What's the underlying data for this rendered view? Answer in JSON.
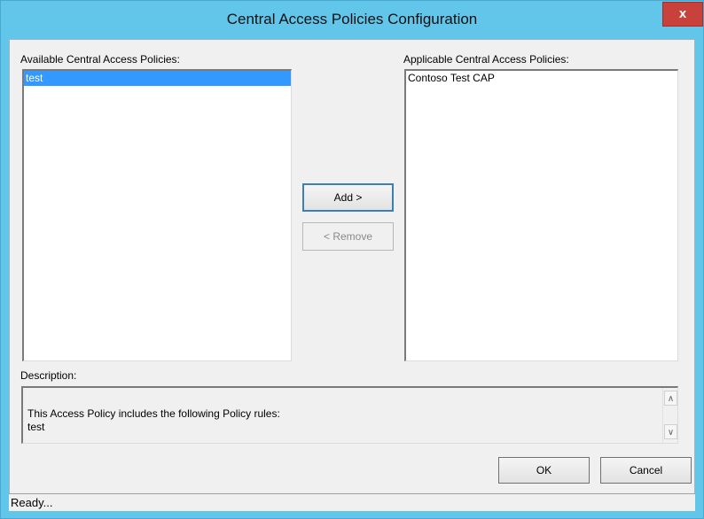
{
  "window": {
    "title": "Central Access Policies Configuration",
    "close_label": "x"
  },
  "available": {
    "label": "Available Central Access Policies:",
    "items": [
      {
        "text": "test",
        "selected": true
      }
    ]
  },
  "applicable": {
    "label": "Applicable Central Access Policies:",
    "items": [
      {
        "text": "Contoso Test CAP",
        "selected": false
      }
    ]
  },
  "buttons": {
    "add": "Add >",
    "remove": "< Remove",
    "ok": "OK",
    "cancel": "Cancel"
  },
  "description": {
    "label": "Description:",
    "line1": "This Access Policy includes the following Policy rules:",
    "line2": "test"
  },
  "status": {
    "text": "Ready..."
  },
  "colors": {
    "titlebar": "#62c6ea",
    "selection": "#3399ff",
    "close": "#c8413a"
  }
}
